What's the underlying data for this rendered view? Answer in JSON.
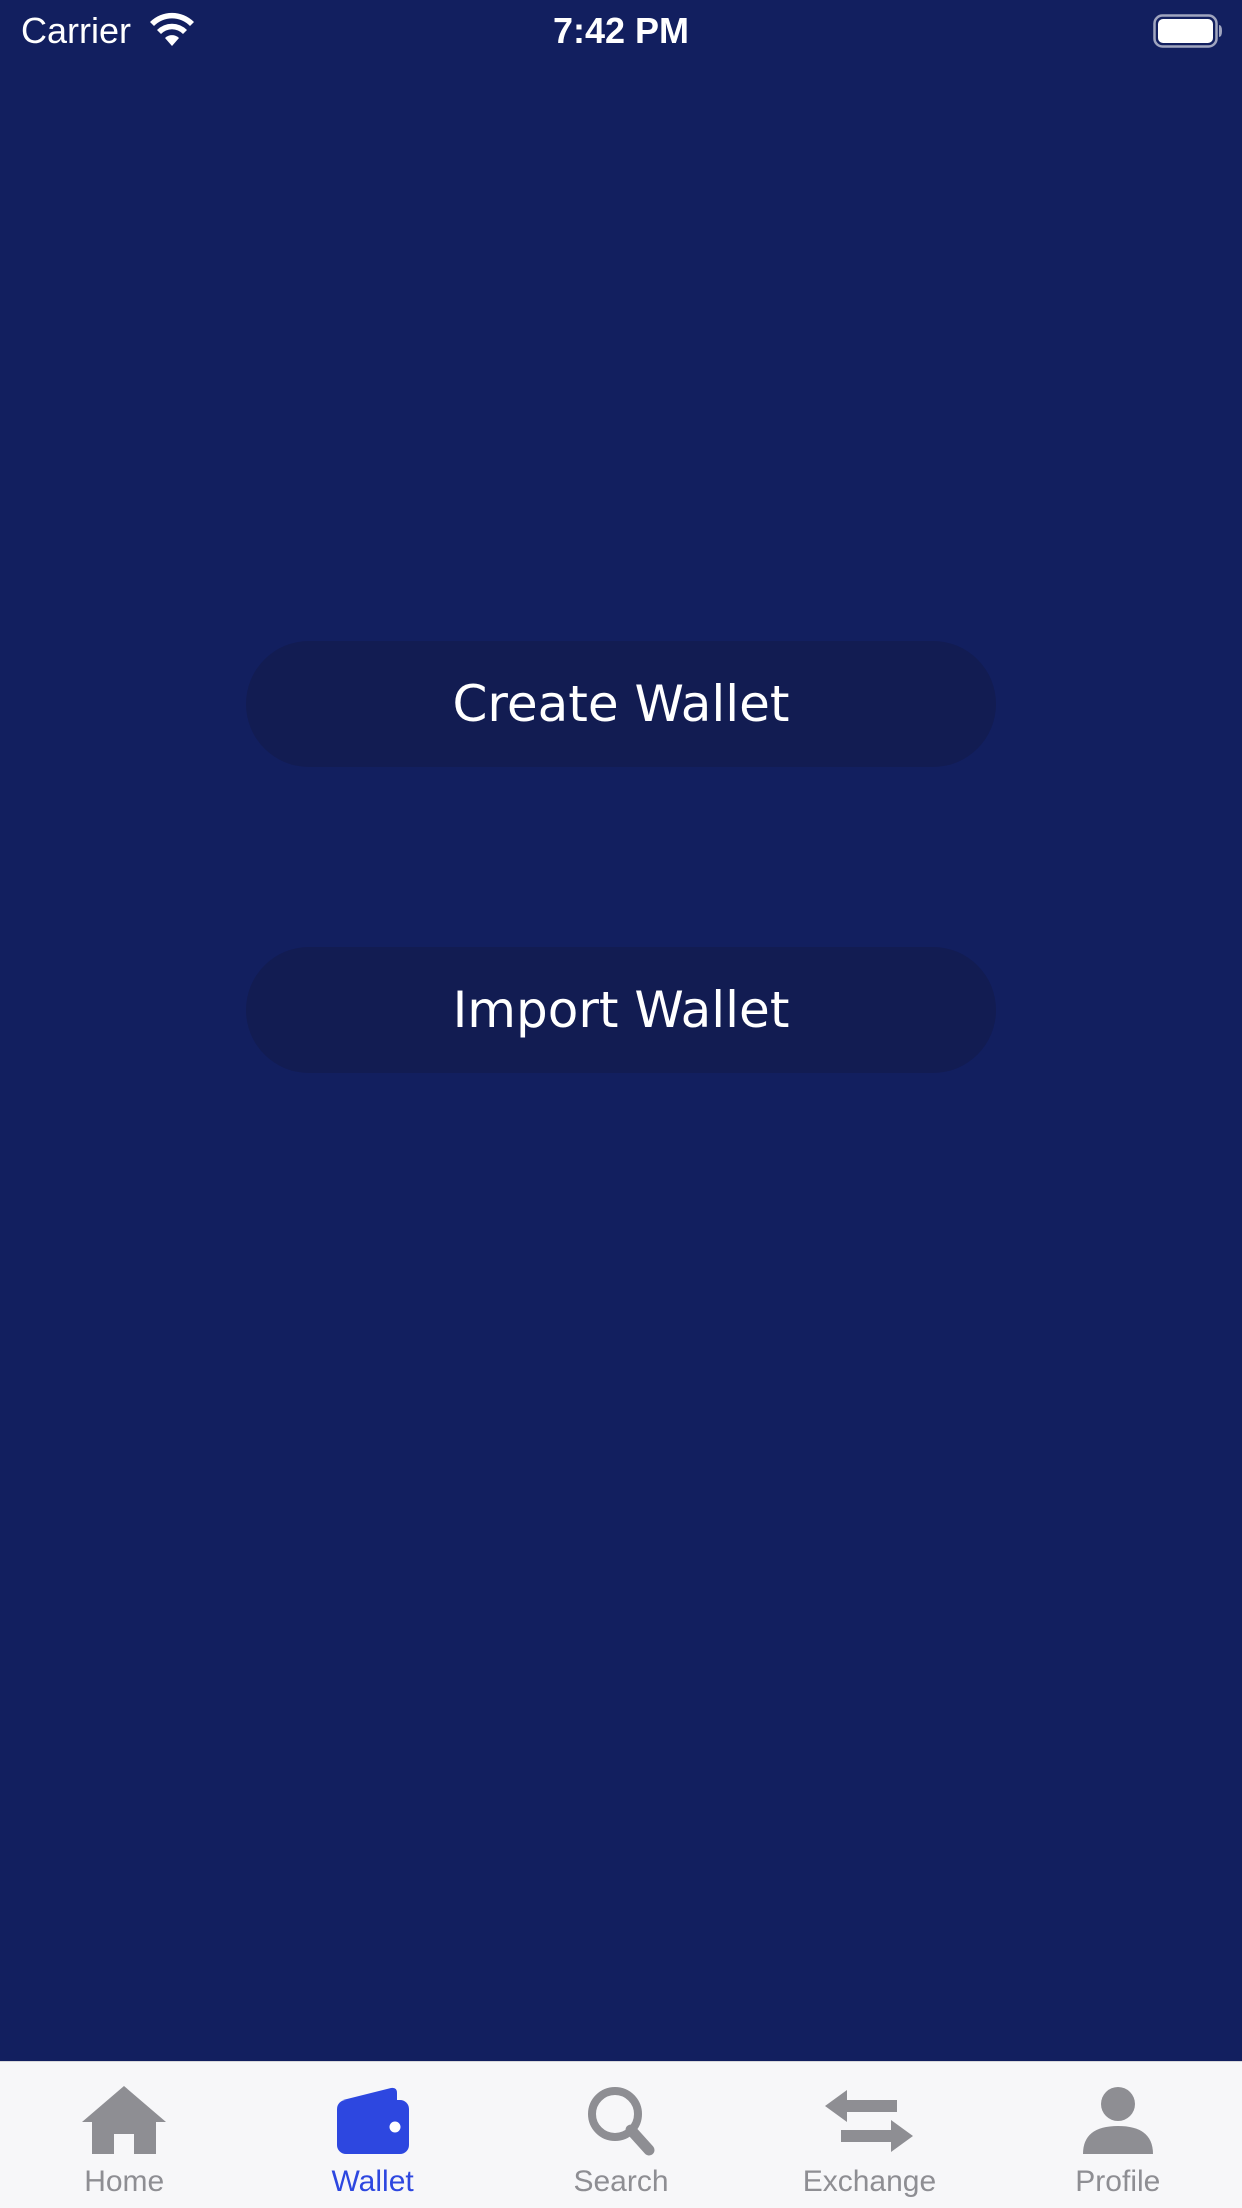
{
  "status_bar": {
    "carrier": "Carrier",
    "time": "7:42 PM"
  },
  "main": {
    "create_wallet_label": "Create Wallet",
    "import_wallet_label": "Import Wallet"
  },
  "tab_bar": {
    "active_color": "#2d47e0",
    "inactive_color": "#8e8e93",
    "items": [
      {
        "label": "Home",
        "icon": "home-icon"
      },
      {
        "label": "Wallet",
        "icon": "wallet-icon",
        "active": true
      },
      {
        "label": "Search",
        "icon": "search-icon"
      },
      {
        "label": "Exchange",
        "icon": "exchange-icon"
      },
      {
        "label": "Profile",
        "icon": "profile-icon"
      }
    ]
  },
  "colors": {
    "background": "#121f5f",
    "button_background": "#121c52",
    "button_text": "#ffffff"
  }
}
